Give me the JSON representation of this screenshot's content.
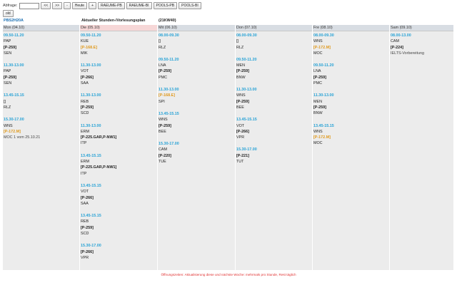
{
  "toolbar": {
    "label": "Abfrage:",
    "input_value": "",
    "prev2": "<<",
    "next2": ">>",
    "minus": "-",
    "heute": "Heute",
    "plus": "+",
    "raeume_pb": "RAEUME-PB",
    "raeume_bi": "RAEUME-BI",
    "pools_pb": "POOLS-PB",
    "pools_bi": "POOLS-BI",
    "old": "old"
  },
  "header": {
    "class_name": "PBS2H20A",
    "title": "Aktueller Stunden-/Vorlesungsplan",
    "week": "(21KW40)"
  },
  "days": [
    {
      "label": "Mon (04.10)",
      "today": false,
      "slots": [
        {
          "time": "09.50-11.20",
          "course": "PAP",
          "room": "[P-259]",
          "room_changed": false,
          "teacher": "SEN",
          "note": ""
        },
        {
          "time": "11.30-13.00",
          "course": "PAP",
          "room": "[P-259]",
          "room_changed": false,
          "teacher": "SEN",
          "note": ""
        },
        {
          "time": "13.45-15.15",
          "course": "[]",
          "room": "",
          "room_changed": false,
          "teacher": "RLZ",
          "note": ""
        },
        {
          "time": "15.30-17.00",
          "course": "WNS",
          "room": "[P-172.M]",
          "room_changed": true,
          "teacher": "",
          "note": "MOC 1 vom 25.10.21"
        }
      ]
    },
    {
      "label": "Die (05.10)",
      "today": true,
      "slots": [
        {
          "time": "09.50-11.20",
          "course": "KUE",
          "room": "[P-168.E]",
          "room_changed": true,
          "teacher": "MIK",
          "note": ""
        },
        {
          "time": "11.30-13.00",
          "course": "VOT",
          "room": "[P-266]",
          "room_changed": false,
          "teacher": "SAA",
          "note": ""
        },
        {
          "time": "11.30-13.00",
          "course": "REB",
          "room": "[P-259]",
          "room_changed": false,
          "teacher": "SCD",
          "note": ""
        },
        {
          "time": "11.30-13.00",
          "course": "ERM",
          "room": "[P-225.GAR,P-NW1]",
          "room_changed": false,
          "teacher": "ITP",
          "note": ""
        },
        {
          "time": "13.45-15.15",
          "course": "ERM",
          "room": "[P-225.GAR,P-NW1]",
          "room_changed": false,
          "teacher": "ITP",
          "note": ""
        },
        {
          "time": "13.45-15.15",
          "course": "VOT",
          "room": "[P-266]",
          "room_changed": false,
          "teacher": "SAA",
          "note": ""
        },
        {
          "time": "13.45-15.15",
          "course": "REB",
          "room": "[P-259]",
          "room_changed": false,
          "teacher": "SCD",
          "note": ""
        },
        {
          "time": "15.30-17.00",
          "course": "",
          "room": "[P-266]",
          "room_changed": false,
          "teacher": "VPR",
          "note": ""
        }
      ]
    },
    {
      "label": "Mit (06.10)",
      "today": false,
      "slots": [
        {
          "time": "08.00-09.30",
          "course": "[]",
          "room": "",
          "room_changed": false,
          "teacher": "RLZ",
          "note": ""
        },
        {
          "time": "09.50-11.20",
          "course": "LNA",
          "room": "[P-259]",
          "room_changed": false,
          "teacher": "PMC",
          "note": ""
        },
        {
          "time": "11.30-13.00",
          "course": "",
          "room": "[P-168.E]",
          "room_changed": true,
          "teacher": "SPI",
          "note": ""
        },
        {
          "time": "13.45-15.15",
          "course": "WNS",
          "room": "[P-259]",
          "room_changed": false,
          "teacher": "BEE",
          "note": ""
        },
        {
          "time": "15.30-17.00",
          "course": "CAM",
          "room": "[P-220]",
          "room_changed": false,
          "teacher": "TUE",
          "note": ""
        }
      ]
    },
    {
      "label": "Don (07.10)",
      "today": false,
      "slots": [
        {
          "time": "08.00-09.30",
          "course": "[]",
          "room": "",
          "room_changed": false,
          "teacher": "RLZ",
          "note": ""
        },
        {
          "time": "09.50-11.20",
          "course": "MEN",
          "room": "[P-259]",
          "room_changed": false,
          "teacher": "BNW",
          "note": ""
        },
        {
          "time": "11.30-13.00",
          "course": "WNS",
          "room": "[P-259]",
          "room_changed": false,
          "teacher": "BEE",
          "note": ""
        },
        {
          "time": "13.45-15.15",
          "course": "VOT",
          "room": "[P-266]",
          "room_changed": false,
          "teacher": "VPR",
          "note": ""
        },
        {
          "time": "15.30-17.00",
          "course": "",
          "room": "[P-221]",
          "room_changed": false,
          "teacher": "TUT",
          "note": ""
        }
      ]
    },
    {
      "label": "Fre (08.10)",
      "today": false,
      "slots": [
        {
          "time": "08.00-09.30",
          "course": "WNS",
          "room": "[P-172.M]",
          "room_changed": true,
          "teacher": "MOC",
          "note": ""
        },
        {
          "time": "09.50-11.20",
          "course": "LNA",
          "room": "[P-259]",
          "room_changed": false,
          "teacher": "PMC",
          "note": ""
        },
        {
          "time": "11.30-13.00",
          "course": "MEN",
          "room": "[P-259]",
          "room_changed": false,
          "teacher": "BNW",
          "note": ""
        },
        {
          "time": "13.45-15.15",
          "course": "WNS",
          "room": "[P-172.M]",
          "room_changed": true,
          "teacher": "MOC",
          "note": ""
        }
      ]
    },
    {
      "label": "Sam (09.10)",
      "today": false,
      "slots": [
        {
          "time": "08.00-13.00",
          "course": "CAM",
          "room": "[P-224]",
          "room_changed": false,
          "teacher": "",
          "note": "IELTS-Vorbereitung"
        }
      ]
    }
  ],
  "footer": "Öffnungszeiten: Aktualisierung diese und nächste Woche: mehrmals pro Stunde, Rest täglich"
}
